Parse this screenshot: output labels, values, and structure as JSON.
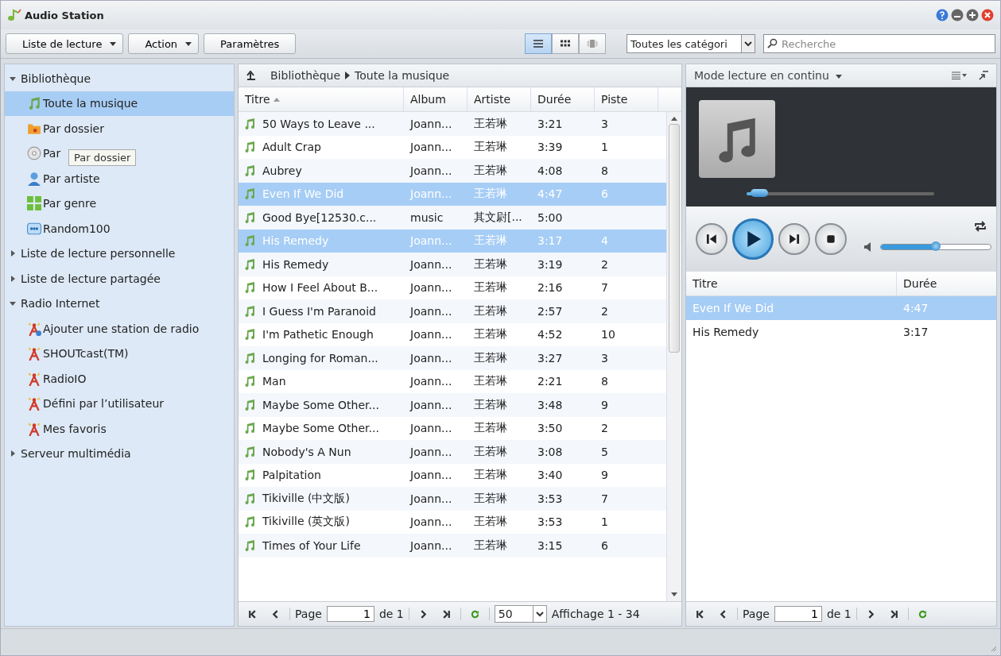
{
  "window": {
    "title": "Audio Station"
  },
  "toolbar": {
    "buttons": [
      {
        "label": "Liste de lecture",
        "has_menu": true
      },
      {
        "label": "Action",
        "has_menu": true
      },
      {
        "label": "Paramètres",
        "has_menu": false
      }
    ],
    "views": [
      {
        "kind": "list",
        "selected": true
      },
      {
        "kind": "grid",
        "selected": false
      },
      {
        "kind": "cover",
        "selected": false
      }
    ],
    "category": {
      "value": "Toutes les catégori"
    },
    "search": {
      "placeholder": "Recherche"
    }
  },
  "sidebar": {
    "items": [
      {
        "label": "Bibliothèque",
        "expanded": true,
        "children": [
          {
            "label": "Toute la musique",
            "kind": "note",
            "selected": true
          },
          {
            "label": "Par dossier",
            "kind": "folder",
            "selected": false
          },
          {
            "label": "Par",
            "kind": "disc",
            "selected": false
          },
          {
            "label": "Par artiste",
            "kind": "person",
            "selected": false
          },
          {
            "label": "Par genre",
            "kind": "genre",
            "selected": false
          },
          {
            "label": "Random100",
            "kind": "random",
            "selected": false
          }
        ]
      },
      {
        "label": "Liste de lecture personnelle",
        "expanded": false
      },
      {
        "label": "Liste de lecture partagée",
        "expanded": false
      },
      {
        "label": "Radio Internet",
        "expanded": true,
        "children": [
          {
            "label": "Ajouter une station de radio",
            "kind": "radio-add",
            "selected": false
          },
          {
            "label": "SHOUTcast(TM)",
            "kind": "radio",
            "selected": false
          },
          {
            "label": "RadioIO",
            "kind": "radio",
            "selected": false
          },
          {
            "label": "Défini par l’utilisateur",
            "kind": "radio",
            "selected": false
          },
          {
            "label": "Mes favoris",
            "kind": "radio",
            "selected": false
          }
        ]
      },
      {
        "label": "Serveur multimédia",
        "expanded": false
      }
    ],
    "tooltip": "Par dossier"
  },
  "library": {
    "breadcrumb": [
      "Bibliothèque",
      "Toute la musique"
    ],
    "columns": [
      {
        "label": "Titre",
        "sorted": true
      },
      {
        "label": "Album",
        "sorted": false
      },
      {
        "label": "Artiste",
        "sorted": false
      },
      {
        "label": "Durée",
        "sorted": false
      },
      {
        "label": "Piste",
        "sorted": false
      }
    ],
    "rows": [
      {
        "title": "50 Ways to Leave ...",
        "album": "Joann...",
        "artist": "王若琳",
        "duration": "3:21",
        "track": "3",
        "selected": false
      },
      {
        "title": "Adult Crap",
        "album": "Joann...",
        "artist": "王若琳",
        "duration": "3:39",
        "track": "1",
        "selected": false
      },
      {
        "title": "Aubrey",
        "album": "Joann...",
        "artist": "王若琳",
        "duration": "4:08",
        "track": "8",
        "selected": false
      },
      {
        "title": "Even If We Did",
        "album": "Joann...",
        "artist": "王若琳",
        "duration": "4:47",
        "track": "6",
        "selected": true
      },
      {
        "title": "Good Bye[12530.c...",
        "album": "music",
        "artist": "其文尉[...",
        "duration": "5:00",
        "track": "",
        "selected": false
      },
      {
        "title": "His Remedy",
        "album": "Joann...",
        "artist": "王若琳",
        "duration": "3:17",
        "track": "4",
        "selected": true
      },
      {
        "title": "His Remedy",
        "album": "Joann...",
        "artist": "王若琳",
        "duration": "3:19",
        "track": "2",
        "selected": false
      },
      {
        "title": "How I Feel About B...",
        "album": "Joann...",
        "artist": "王若琳",
        "duration": "2:16",
        "track": "7",
        "selected": false
      },
      {
        "title": "I Guess I'm Paranoid",
        "album": "Joann...",
        "artist": "王若琳",
        "duration": "2:57",
        "track": "2",
        "selected": false
      },
      {
        "title": "I'm Pathetic Enough",
        "album": "Joann...",
        "artist": "王若琳",
        "duration": "4:52",
        "track": "10",
        "selected": false
      },
      {
        "title": "Longing for Roman...",
        "album": "Joann...",
        "artist": "王若琳",
        "duration": "3:27",
        "track": "3",
        "selected": false
      },
      {
        "title": "Man",
        "album": "Joann...",
        "artist": "王若琳",
        "duration": "2:21",
        "track": "8",
        "selected": false
      },
      {
        "title": "Maybe Some Other...",
        "album": "Joann...",
        "artist": "王若琳",
        "duration": "3:48",
        "track": "9",
        "selected": false
      },
      {
        "title": "Maybe Some Other...",
        "album": "Joann...",
        "artist": "王若琳",
        "duration": "3:50",
        "track": "2",
        "selected": false
      },
      {
        "title": "Nobody's A Nun",
        "album": "Joann...",
        "artist": "王若琳",
        "duration": "3:08",
        "track": "5",
        "selected": false
      },
      {
        "title": "Palpitation",
        "album": "Joann...",
        "artist": "王若琳",
        "duration": "3:40",
        "track": "9",
        "selected": false
      },
      {
        "title": "Tikiville (中文版)",
        "album": "Joann...",
        "artist": "王若琳",
        "duration": "3:53",
        "track": "7",
        "selected": false
      },
      {
        "title": "Tikiville (英文版)",
        "album": "Joann...",
        "artist": "王若琳",
        "duration": "3:53",
        "track": "1",
        "selected": false
      },
      {
        "title": "Times of Your Life",
        "album": "Joann...",
        "artist": "王若琳",
        "duration": "3:15",
        "track": "6",
        "selected": false
      }
    ],
    "pager": {
      "page_label": "Page",
      "page": "1",
      "of": "de 1",
      "per_page": "50",
      "display": "Affichage 1 - 34"
    }
  },
  "player": {
    "mode": "Mode lecture en continu",
    "progress": {
      "level": 0.03
    },
    "volume": {
      "level": 0.5
    },
    "columns": [
      "Titre",
      "Durée"
    ],
    "queue": [
      {
        "title": "Even If We Did",
        "duration": "4:47",
        "selected": true
      },
      {
        "title": "His Remedy",
        "duration": "3:17",
        "selected": false
      }
    ],
    "pager": {
      "page_label": "Page",
      "page": "1",
      "of": "de 1"
    }
  }
}
